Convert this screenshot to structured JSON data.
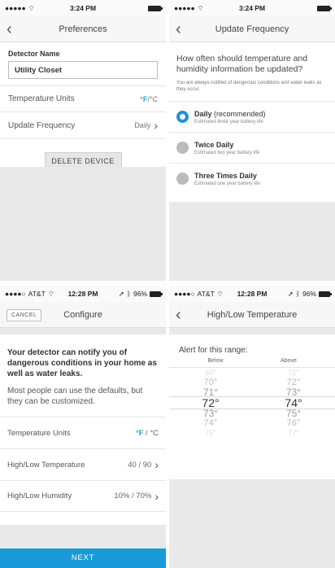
{
  "status": {
    "time_a": "3:24 PM",
    "time_b": "12:28 PM",
    "carrier_dots": "●●●●●",
    "carrier_dots_b": "●●●●○",
    "carrier": "AT&T",
    "battery_pct": "96%"
  },
  "preferences": {
    "title": "Preferences",
    "detector_label": "Detector Name",
    "detector_value": "Utility Closet",
    "temp_units_label": "Temperature Units",
    "temp_unit_f": "°F",
    "temp_unit_c": "/°C",
    "update_freq_label": "Update Frequency",
    "update_freq_value": "Daily",
    "delete_label": "DELETE DEVICE"
  },
  "update_frequency": {
    "title": "Update Frequency",
    "question": "How often should temperature and humidity information be updated?",
    "note": "You are always notified of dangerous conditions and water leaks as they occur.",
    "options": [
      {
        "name": "Daily",
        "extra": "(recommended)",
        "sub": "Estimated three year battery life",
        "selected": true
      },
      {
        "name": "Twice Daily",
        "extra": "",
        "sub": "Estimated two year battery life",
        "selected": false
      },
      {
        "name": "Three Times Daily",
        "extra": "",
        "sub": "Estimated one year battery life",
        "selected": false
      }
    ]
  },
  "configure": {
    "cancel_label": "CANCEL",
    "title": "Configure",
    "intro_bold": "Your detector can notify you of dangerous conditions in your home as well as water leaks.",
    "intro_text": "Most people can use the defaults, but they can be customized.",
    "temp_units_label": "Temperature Units",
    "temp_unit_f": "°F",
    "temp_unit_c": " / °C",
    "hilo_temp_label": "High/Low Temperature",
    "hilo_temp_value": "40 / 90",
    "hilo_hum_label": "High/Low Humidity",
    "hilo_hum_value": "10% / 70%",
    "next_label": "NEXT"
  },
  "hilo": {
    "title": "High/Low Temperature",
    "alert_label": "Alert for this range:",
    "below_label": "Below",
    "above_label": "Above",
    "below_values": [
      "69°",
      "70°",
      "71°",
      "72°",
      "73°",
      "74°",
      "75°"
    ],
    "above_values": [
      "71°",
      "72°",
      "73°",
      "74°",
      "75°",
      "76°",
      "77°"
    ],
    "below_selected": "72°",
    "above_selected": "74°"
  },
  "colors": {
    "accent": "#1a9ad8",
    "unit_blue": "#2a9fd8"
  }
}
